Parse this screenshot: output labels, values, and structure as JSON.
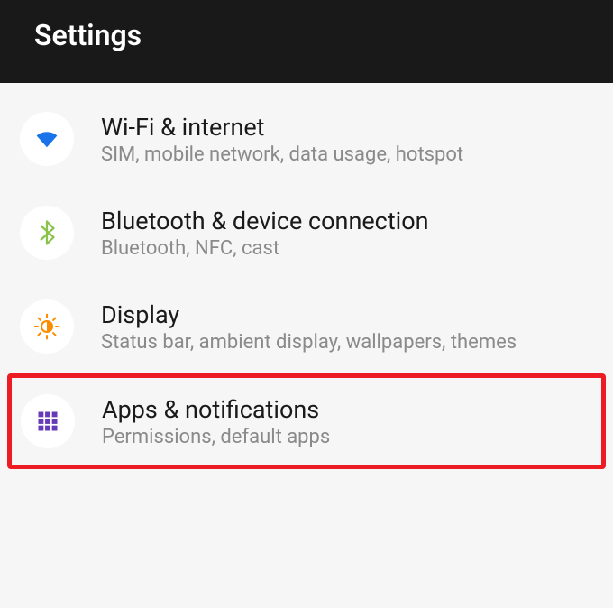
{
  "header": {
    "title": "Settings"
  },
  "items": [
    {
      "id": "wifi",
      "title": "Wi-Fi & internet",
      "subtitle": "SIM, mobile network, data usage, hotspot",
      "highlighted": false
    },
    {
      "id": "bluetooth",
      "title": "Bluetooth & device connection",
      "subtitle": "Bluetooth, NFC, cast",
      "highlighted": false
    },
    {
      "id": "display",
      "title": "Display",
      "subtitle": "Status bar, ambient display, wallpapers, themes",
      "highlighted": false
    },
    {
      "id": "apps",
      "title": "Apps & notifications",
      "subtitle": "Permissions, default apps",
      "highlighted": true
    }
  ],
  "colors": {
    "wifi": "#1a73e8",
    "bluetooth": "#8bc34a",
    "display": "#fb8c00",
    "apps": "#673ab7",
    "highlight": "#ed1c24"
  }
}
